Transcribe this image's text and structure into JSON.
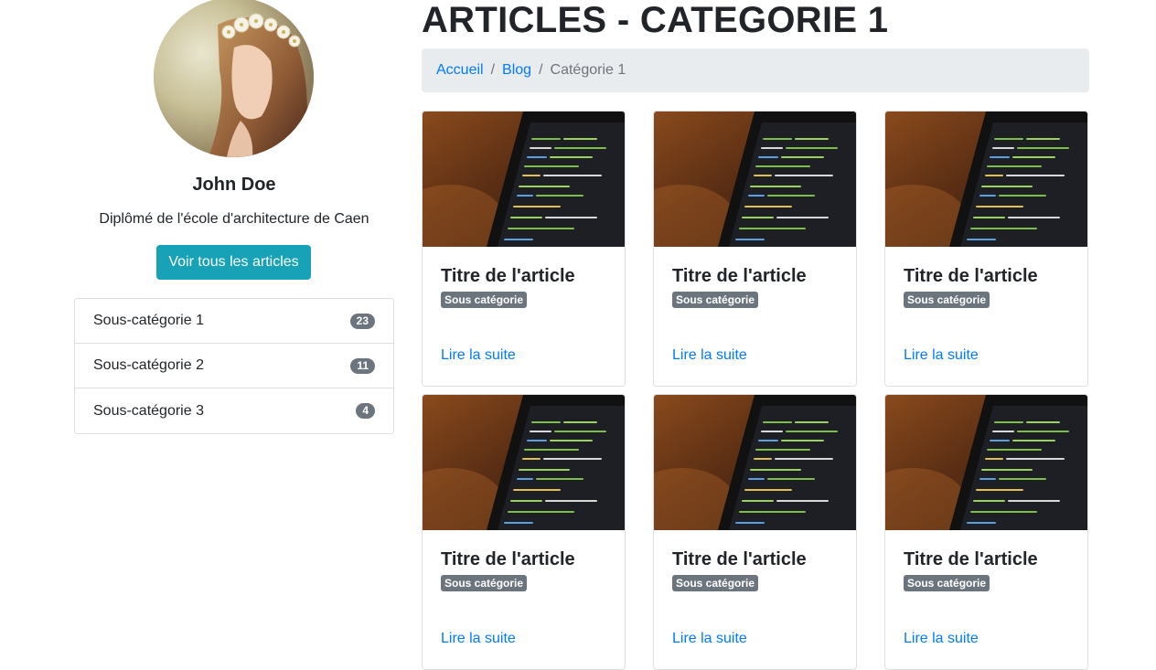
{
  "profile": {
    "name": "John Doe",
    "description": "Diplômé de l'école d'architecture de Caen",
    "button_label": "Voir tous les articles"
  },
  "subcategories": [
    {
      "label": "Sous-catégorie 1",
      "count": "23"
    },
    {
      "label": "Sous-catégorie 2",
      "count": "11"
    },
    {
      "label": "Sous-catégorie 3",
      "count": "4"
    }
  ],
  "page": {
    "title": "ARTICLES - CATEGORIE 1"
  },
  "breadcrumb": {
    "items": [
      "Accueil",
      "Blog",
      "Catégorie 1"
    ],
    "separator": "/"
  },
  "articles": [
    {
      "title": "Titre de l'article",
      "badge": "Sous catégorie",
      "link": "Lire la suite"
    },
    {
      "title": "Titre de l'article",
      "badge": "Sous catégorie",
      "link": "Lire la suite"
    },
    {
      "title": "Titre de l'article",
      "badge": "Sous catégorie",
      "link": "Lire la suite"
    },
    {
      "title": "Titre de l'article",
      "badge": "Sous catégorie",
      "link": "Lire la suite"
    },
    {
      "title": "Titre de l'article",
      "badge": "Sous catégorie",
      "link": "Lire la suite"
    },
    {
      "title": "Titre de l'article",
      "badge": "Sous catégorie",
      "link": "Lire la suite"
    }
  ],
  "colors": {
    "primary_link": "#007bff",
    "info_button": "#17a2b8",
    "badge": "#6c757d",
    "breadcrumb_bg": "#e9ecef"
  }
}
